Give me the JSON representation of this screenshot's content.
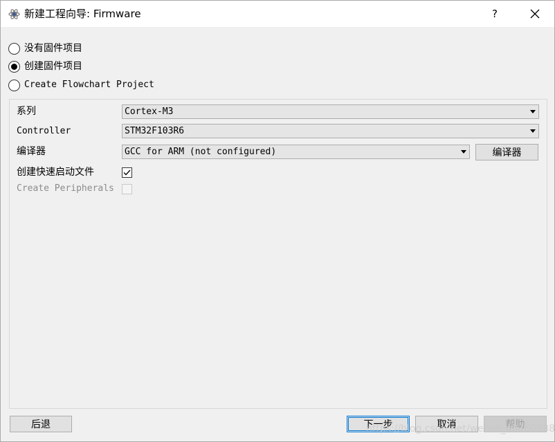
{
  "window": {
    "title": "新建工程向导: Firmware",
    "help_glyph": "?",
    "close_glyph": "✕"
  },
  "project_type": {
    "options": [
      {
        "label": "没有固件项目",
        "checked": false
      },
      {
        "label": "创建固件项目",
        "checked": true
      },
      {
        "label": "Create Flowchart Project",
        "checked": false
      }
    ]
  },
  "form": {
    "series_label": "系列",
    "series_value": "Cortex-M3",
    "controller_label": "Controller",
    "controller_value": "STM32F103R6",
    "compiler_label": "编译器",
    "compiler_value": "GCC for ARM (not configured)",
    "compiler_button": "编译器",
    "quickstart_label": "创建快速启动文件",
    "quickstart_checked": true,
    "peripherals_label": "Create Peripherals",
    "peripherals_checked": false
  },
  "footer": {
    "back_label": "后退",
    "next_label": "下一步",
    "cancel_label": "取消",
    "help_label": "帮助"
  },
  "watermark": "https://blog.csdn.net/weixin_48360088"
}
